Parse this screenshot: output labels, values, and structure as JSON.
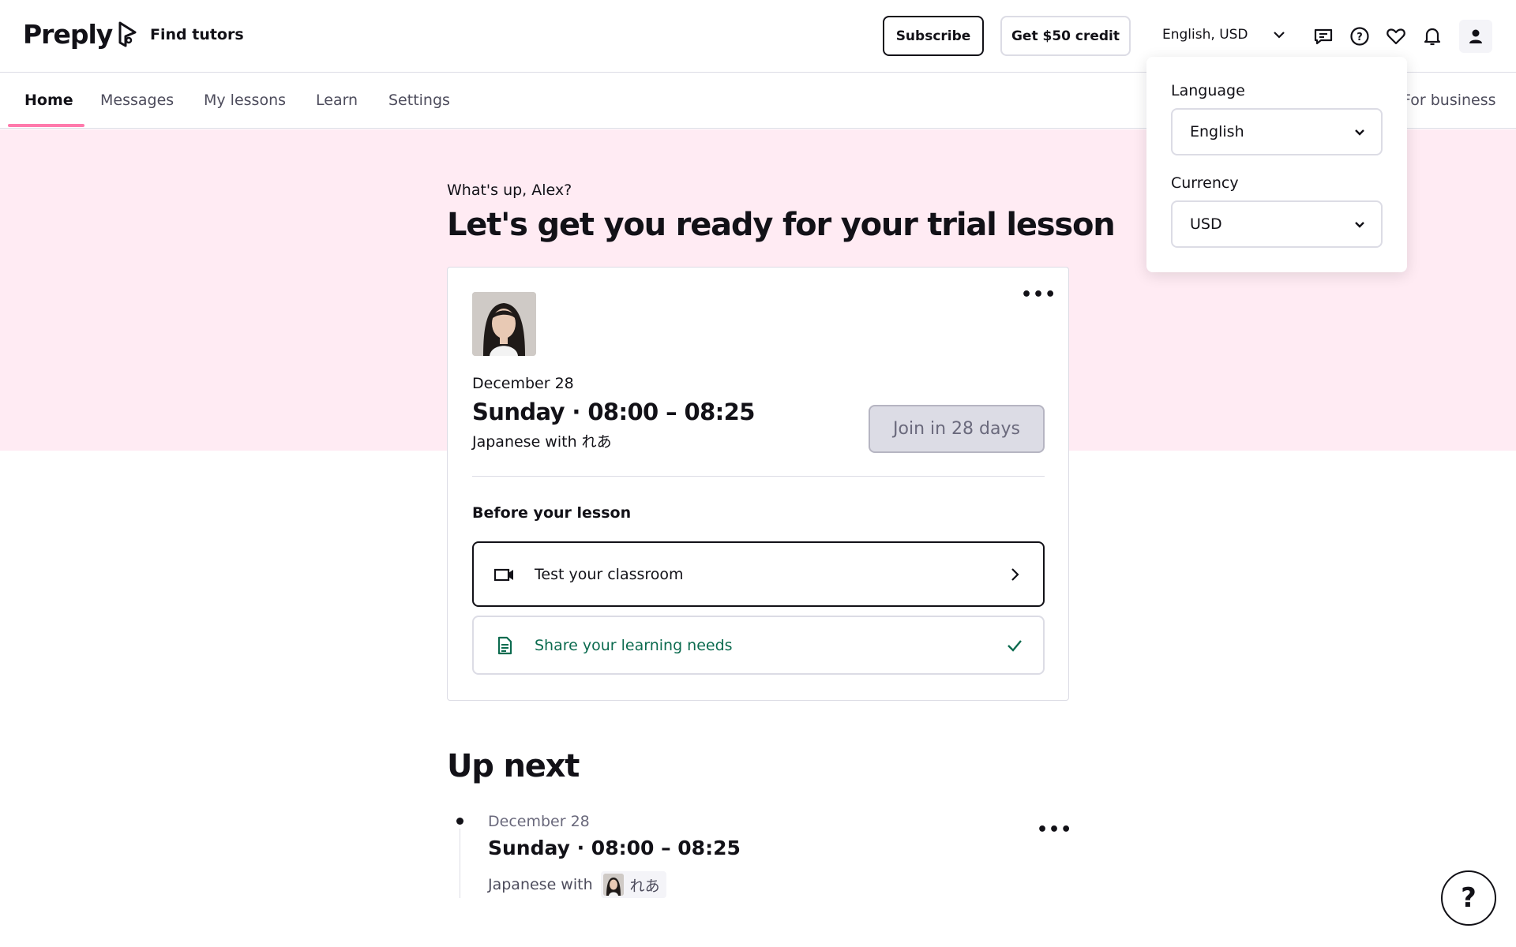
{
  "header": {
    "logo_text": "Preply",
    "find_tutors": "Find tutors",
    "subscribe": "Subscribe",
    "credit": "Get $50 credit",
    "lang_currency": "English, USD"
  },
  "nav": {
    "items": [
      {
        "label": "Home",
        "active": true
      },
      {
        "label": "Messages",
        "active": false
      },
      {
        "label": "My lessons",
        "active": false
      },
      {
        "label": "Learn",
        "active": false
      },
      {
        "label": "Settings",
        "active": false
      }
    ],
    "business": "For business"
  },
  "hero": {
    "greeting": "What's up, Alex?",
    "headline": "Let's get you ready for your trial lesson"
  },
  "lesson_card": {
    "more": "•••",
    "date": "December 28",
    "time": "Sunday · 08:00 – 08:25",
    "subject": "Japanese with れあ",
    "join_label": "Join in 28 days",
    "before_title": "Before your lesson",
    "tasks": [
      {
        "label": "Test your classroom",
        "icon": "video-camera-icon",
        "end_icon": "chevron-right-icon",
        "done": false
      },
      {
        "label": "Share your learning needs",
        "icon": "document-icon",
        "end_icon": "check-icon",
        "done": true
      }
    ]
  },
  "up_next": {
    "title": "Up next",
    "more": "•••",
    "date": "December 28",
    "time": "Sunday · 08:00 – 08:25",
    "subject_prefix": "Japanese with",
    "tutor_name": "れあ"
  },
  "popover": {
    "language_label": "Language",
    "language_value": "English",
    "currency_label": "Currency",
    "currency_value": "USD"
  },
  "help": {
    "label": "?"
  },
  "colors": {
    "accent_pink": "#ff7aac",
    "band_pink": "#ffebf3",
    "success_green": "#0c6b4f",
    "text_dark": "#121117"
  }
}
